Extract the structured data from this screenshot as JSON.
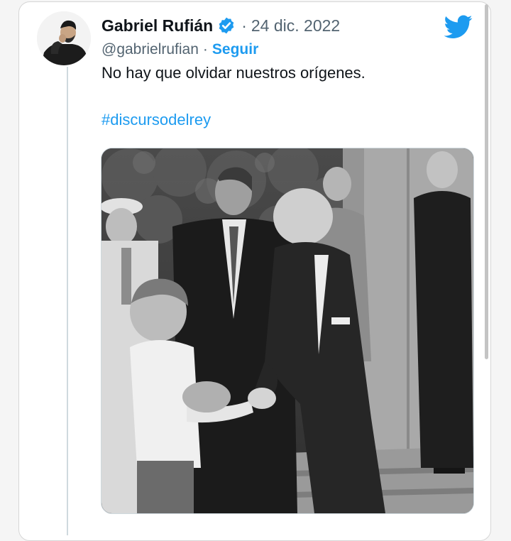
{
  "tweet": {
    "author_name": "Gabriel Rufián",
    "verified_icon": "verified-badge-icon",
    "separator": "·",
    "date": "24 dic. 2022",
    "handle": "@gabrielrufian",
    "handle_separator": "·",
    "follow_label": "Seguir",
    "text": "No hay que olvidar nuestros orígenes.",
    "hashtag": "#discursodelrey"
  },
  "icons": {
    "brand": "twitter-bird-icon",
    "avatar": "avatar"
  },
  "colors": {
    "text_primary": "#0f1419",
    "text_secondary": "#536471",
    "link_blue": "#1d9bf0",
    "twitter_blue": "#1d9bf0"
  },
  "media": {
    "type": "black-and-white photograph"
  }
}
